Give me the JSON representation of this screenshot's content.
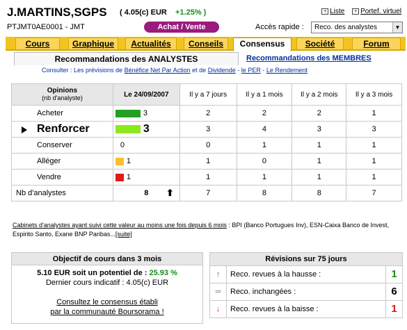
{
  "header": {
    "ticker": "J.MARTINS,SGPS",
    "price": "( 4.05(c) EUR",
    "change": "+1.25% )",
    "isin": "PTJMT0AE0001 - JMT",
    "achat_vente": "Achat / Vente",
    "liste": "Liste",
    "portef": "Portef. virtuel",
    "acces_label": "Accès rapide :",
    "acces_value": "Reco. des analystes"
  },
  "tabs": [
    "Cours",
    "Graphique",
    "Actualités",
    "Conseils",
    "Consensus",
    "Société",
    "Forum"
  ],
  "active_tab": "Consensus",
  "subtabs": {
    "analystes": "Recommandations des ANALYSTES",
    "membres": "Recommandations des MEMBRES"
  },
  "consult": {
    "prefix": "Consulter : Les prévisions de",
    "bna": "Bénéfice Net Par Action",
    "et": "et de",
    "div": "Dividende",
    "sep": "-",
    "per": "le PER",
    "sep2": "-",
    "rend": "Le Rendement"
  },
  "opinions_table": {
    "col_opinions": "Opinions",
    "col_opinions_sub": "(nb d'analyste)",
    "col_date": "Le 24/09/2007",
    "col_7j": "Il y a 7 jours",
    "col_1m": "Il y a 1 mois",
    "col_2m": "Il y a 2 mois",
    "col_3m": "Il y a 3 mois",
    "rows": [
      {
        "label": "Acheter",
        "today": "3",
        "bar_color": "#22a022",
        "bar_value": 3,
        "v7": "2",
        "v1m": "2",
        "v2m": "2",
        "v3m": "1"
      },
      {
        "label": "Renforcer",
        "today": "3",
        "bar_color": "#8ee81e",
        "bar_value": 3,
        "v7": "3",
        "v1m": "4",
        "v2m": "3",
        "v3m": "3"
      },
      {
        "label": "Conserver",
        "today": "0",
        "bar_color": "",
        "bar_value": 0,
        "v7": "0",
        "v1m": "1",
        "v2m": "1",
        "v3m": "1"
      },
      {
        "label": "Alléger",
        "today": "1",
        "bar_color": "#f8c030",
        "bar_value": 1,
        "v7": "1",
        "v1m": "0",
        "v2m": "1",
        "v3m": "1"
      },
      {
        "label": "Vendre",
        "today": "1",
        "bar_color": "#e21a1a",
        "bar_value": 1,
        "v7": "1",
        "v1m": "1",
        "v2m": "1",
        "v3m": "1"
      }
    ],
    "nb_label": "Nb d'analystes",
    "nb": {
      "today": "8",
      "v7": "7",
      "v1m": "8",
      "v2m": "8",
      "v3m": "7"
    }
  },
  "cabinets": {
    "link": "Cabinets d'analystes ayant suivi cette valeur au moins une fois depuis 6 mois",
    "text": ": BPI (Banco Portugues Inv), ESN-Caixa Banco de Invest, Espirito Santo, Exane BNP Paribas...",
    "suite": "[suite]"
  },
  "objectif": {
    "title": "Objectif de cours dans 3 mois",
    "line1_prefix": "5.10 EUR soit un potentiel de :",
    "line1_value": "25.93 %",
    "line2": "Dernier cours indicatif : 4.05(c) EUR",
    "link1": "Consultez le consensus établi",
    "link2": "par la communauté Boursorama !"
  },
  "revisions": {
    "title": "Révisions sur 75 jours",
    "hausse_label": "Reco. revues à la hausse :",
    "hausse": "1",
    "inch_label": "Reco. inchangées :",
    "inch": "6",
    "baisse_label": "Reco. revues à la baisse :",
    "baisse": "1"
  }
}
